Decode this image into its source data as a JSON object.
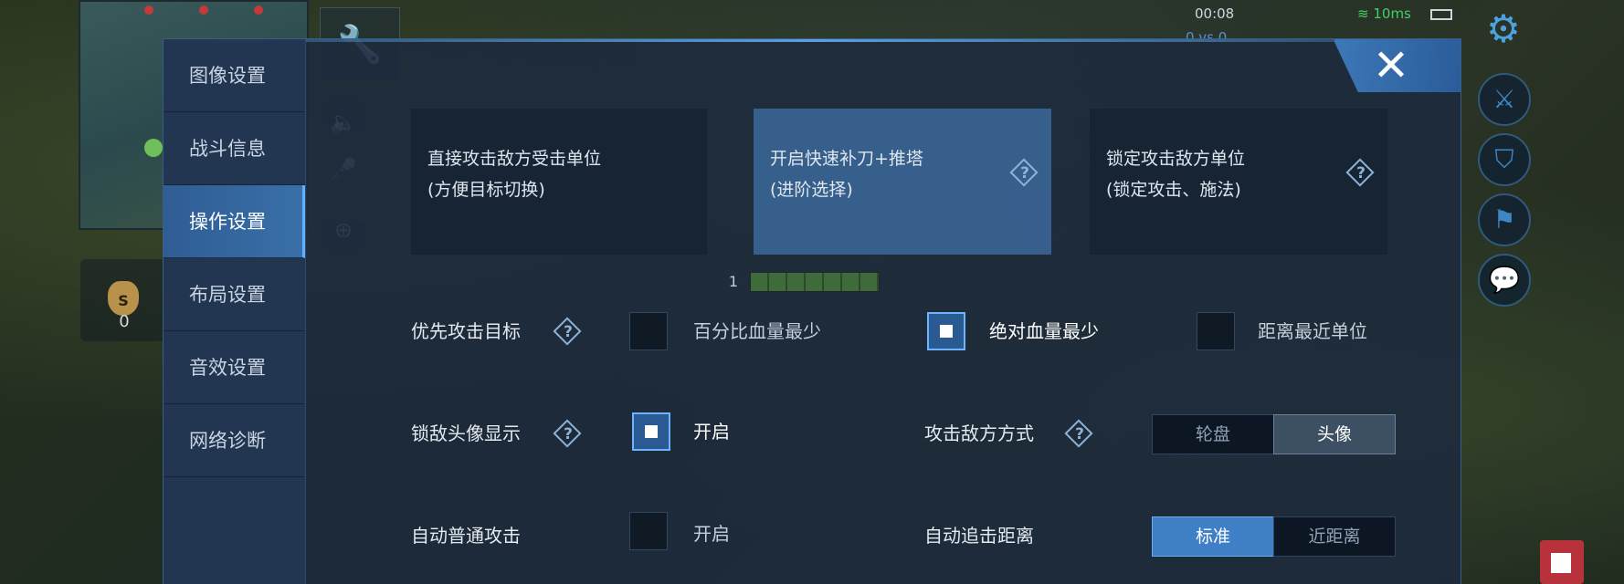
{
  "hud": {
    "time": "00:08",
    "score": "0 vs 0",
    "ping": "10ms",
    "gold": "0",
    "gold_icon_letter": "S"
  },
  "panel": {
    "close_icon": "close-icon",
    "sidebar": [
      {
        "label": "图像设置"
      },
      {
        "label": "战斗信息"
      },
      {
        "label": "操作设置",
        "active": true
      },
      {
        "label": "布局设置"
      },
      {
        "label": "音效设置"
      },
      {
        "label": "网络诊断"
      }
    ],
    "modes": [
      {
        "line1": "直接攻击敌方受击单位",
        "line2": "(方便目标切换)",
        "selected": false
      },
      {
        "line1": "开启快速补刀+推塔",
        "line2": "(进阶选择)",
        "selected": true
      },
      {
        "line1": "锁定攻击敌方单位",
        "line2": "(锁定攻击、施法)",
        "selected": false
      }
    ],
    "priority": {
      "label": "优先攻击目标",
      "options": [
        {
          "label": "百分比血量最少",
          "checked": false
        },
        {
          "label": "绝对血量最少",
          "checked": true
        },
        {
          "label": "距离最近单位",
          "checked": false
        }
      ]
    },
    "lock_avatar": {
      "label": "锁敌头像显示",
      "option": "开启",
      "checked": true
    },
    "attack_method": {
      "label": "攻击敌方方式",
      "options": [
        "轮盘",
        "头像"
      ],
      "selected": "头像"
    },
    "auto_attack": {
      "label": "自动普通攻击",
      "option": "开启",
      "checked": false
    },
    "chase_distance": {
      "label": "自动追击距离",
      "options": [
        "标准",
        "近距离"
      ],
      "selected": "标准"
    },
    "xp_level": "1"
  }
}
